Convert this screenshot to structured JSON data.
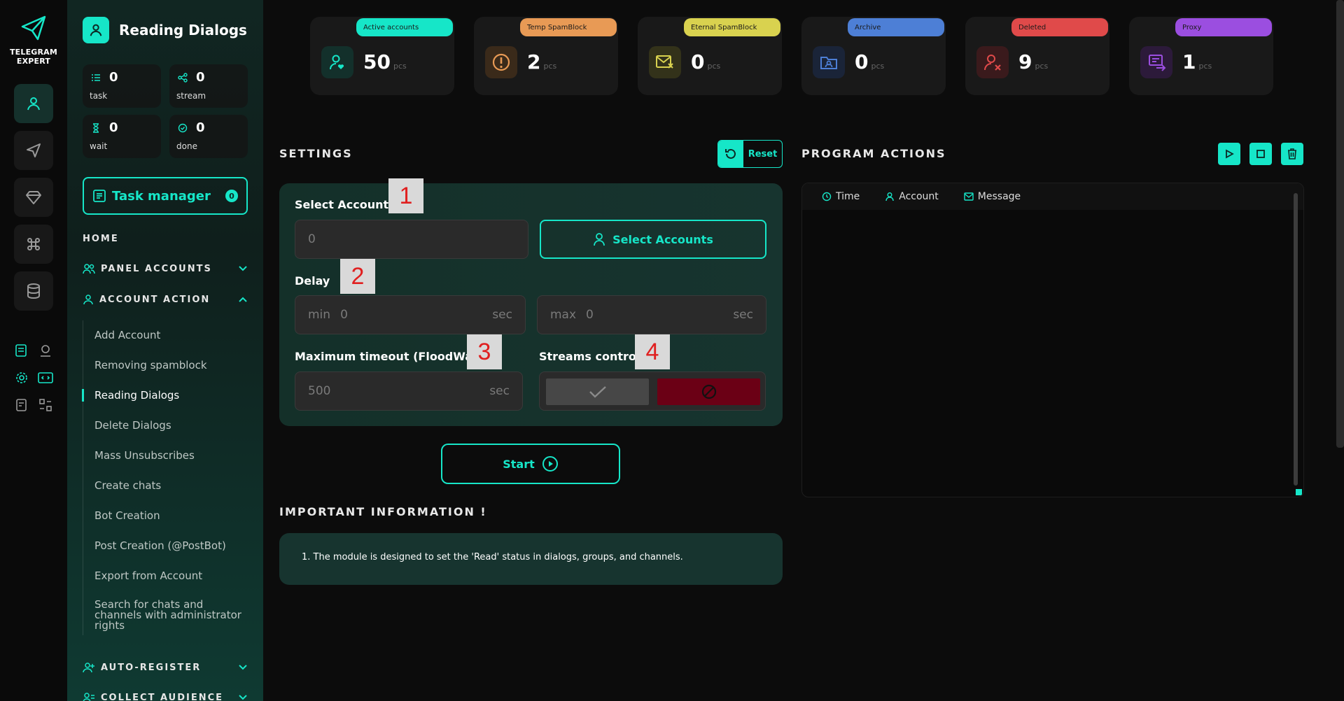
{
  "app": {
    "brand_line1": "TELEGRAM",
    "brand_line2": "EXPERT",
    "accent": "#16e6c8"
  },
  "sidebar": {
    "title": "Reading Dialogs",
    "stats": [
      {
        "value": "0",
        "label": "task"
      },
      {
        "value": "0",
        "label": "stream"
      },
      {
        "value": "0",
        "label": "wait"
      },
      {
        "value": "0",
        "label": "done"
      }
    ],
    "task_manager": {
      "label": "Task manager",
      "count": "0"
    },
    "home": "HOME",
    "panel_accounts": "PANEL ACCOUNTS",
    "account_action": "ACCOUNT ACTION",
    "menu": [
      "Add Account",
      "Removing spamblock",
      "Reading Dialogs",
      "Delete Dialogs",
      "Mass Unsubscribes",
      "Create chats",
      "Bot Creation",
      "Post Creation (@PostBot)",
      "Export from Account",
      "Search for chats and channels with administrator rights"
    ],
    "active_item": "Reading Dialogs",
    "auto_register": "AUTO-REGISTER",
    "collect_audience": "COLLECT AUDIENCE"
  },
  "status_cards": [
    {
      "label": "Active accounts",
      "value": "50",
      "unit": "pcs",
      "color": "#16e6c8",
      "icon": "user-heart-icon"
    },
    {
      "label": "Temp SpamBlock",
      "value": "2",
      "unit": "pcs",
      "color": "#e89a55",
      "icon": "alert-circle-icon"
    },
    {
      "label": "Eternal SpamBlock",
      "value": "0",
      "unit": "pcs",
      "color": "#d9d24f",
      "icon": "mail-blocked-icon"
    },
    {
      "label": "Archive",
      "value": "0",
      "unit": "pcs",
      "color": "#4d7fd6",
      "icon": "archive-folder-icon"
    },
    {
      "label": "Deleted",
      "value": "9",
      "unit": "pcs",
      "color": "#e04a4a",
      "icon": "user-x-icon"
    },
    {
      "label": "Proxy",
      "value": "1",
      "unit": "pcs",
      "color": "#9b4ee0",
      "icon": "proxy-icon"
    }
  ],
  "settings": {
    "title": "SETTINGS",
    "reset": "Reset",
    "select_accounts_label": "Select Accounts",
    "select_accounts_value": "0",
    "select_accounts_button": "Select Accounts",
    "delay_label": "Delay",
    "delay_min_prefix": "min",
    "delay_min_value": "0",
    "delay_max_prefix": "max",
    "delay_max_value": "0",
    "unit_sec": "sec",
    "timeout_label": "Maximum timeout (FloodWait)",
    "timeout_value": "500",
    "streams_label": "Streams control",
    "tags": [
      "1",
      "2",
      "3",
      "4"
    ],
    "start": "Start"
  },
  "info": {
    "title": "IMPORTANT INFORMATION !",
    "text": "1. The module is designed to set the 'Read' status in dialogs, groups, and channels."
  },
  "actions": {
    "title": "PROGRAM ACTIONS",
    "columns": [
      "Time",
      "Account",
      "Message"
    ]
  }
}
